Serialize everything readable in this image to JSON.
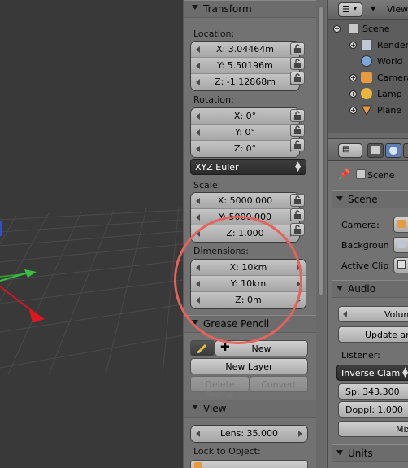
{
  "viewport": {
    "background": "#393939",
    "x_axis_color": "#d0161f",
    "y_axis_color": "#36c23b"
  },
  "npanel": {
    "transform": {
      "title": "Transform",
      "location_label": "Location:",
      "location": [
        "X: 3.04464m",
        "Y: 5.50196m",
        "Z: -1.12868m"
      ],
      "rotation_label": "Rotation:",
      "rotation": [
        "X: 0°",
        "Y: 0°",
        "Z: 0°"
      ],
      "rotation_mode": "XYZ Euler",
      "scale_label": "Scale:",
      "scale": [
        "X: 5000.000",
        "Y: 5000.000",
        "Z: 1.000"
      ],
      "dimensions_label": "Dimensions:",
      "dimensions": [
        "X: 10km",
        "Y: 10km",
        "Z: 0m"
      ]
    },
    "grease_pencil": {
      "title": "Grease Pencil",
      "new_label": "New",
      "new_layer_label": "New Layer",
      "delete_frame_label": "Delete Frame",
      "convert_label": "Convert"
    },
    "view": {
      "title": "View",
      "lens": "Lens: 35.000",
      "lock_label": "Lock to Object:"
    }
  },
  "outliner": {
    "view_label": "View",
    "items": [
      {
        "label": "Scene",
        "icon": "scene-icon"
      },
      {
        "label": "Render",
        "icon": "render-layers-icon"
      },
      {
        "label": "World",
        "icon": "world-icon"
      },
      {
        "label": "Camera",
        "icon": "camera-icon"
      },
      {
        "label": "Lamp",
        "icon": "lamp-icon"
      },
      {
        "label": "Plane",
        "icon": "mesh-icon"
      }
    ]
  },
  "properties": {
    "context_label": "Scene",
    "scene_panel": "Scene",
    "camera_label": "Camera:",
    "background_label": "Backgroun",
    "active_clip_label": "Active Clip",
    "audio_panel": "Audio",
    "volume_label": "Volum",
    "update_anim_label": "Update ani",
    "listener_label": "Listener:",
    "distance_model": "Inverse Clam",
    "speed": "Sp: 343.300",
    "doppler": "Doppl: 1.000",
    "mix_label": "Mix",
    "units_panel": "Units"
  },
  "annotation_color": "#e5635a"
}
